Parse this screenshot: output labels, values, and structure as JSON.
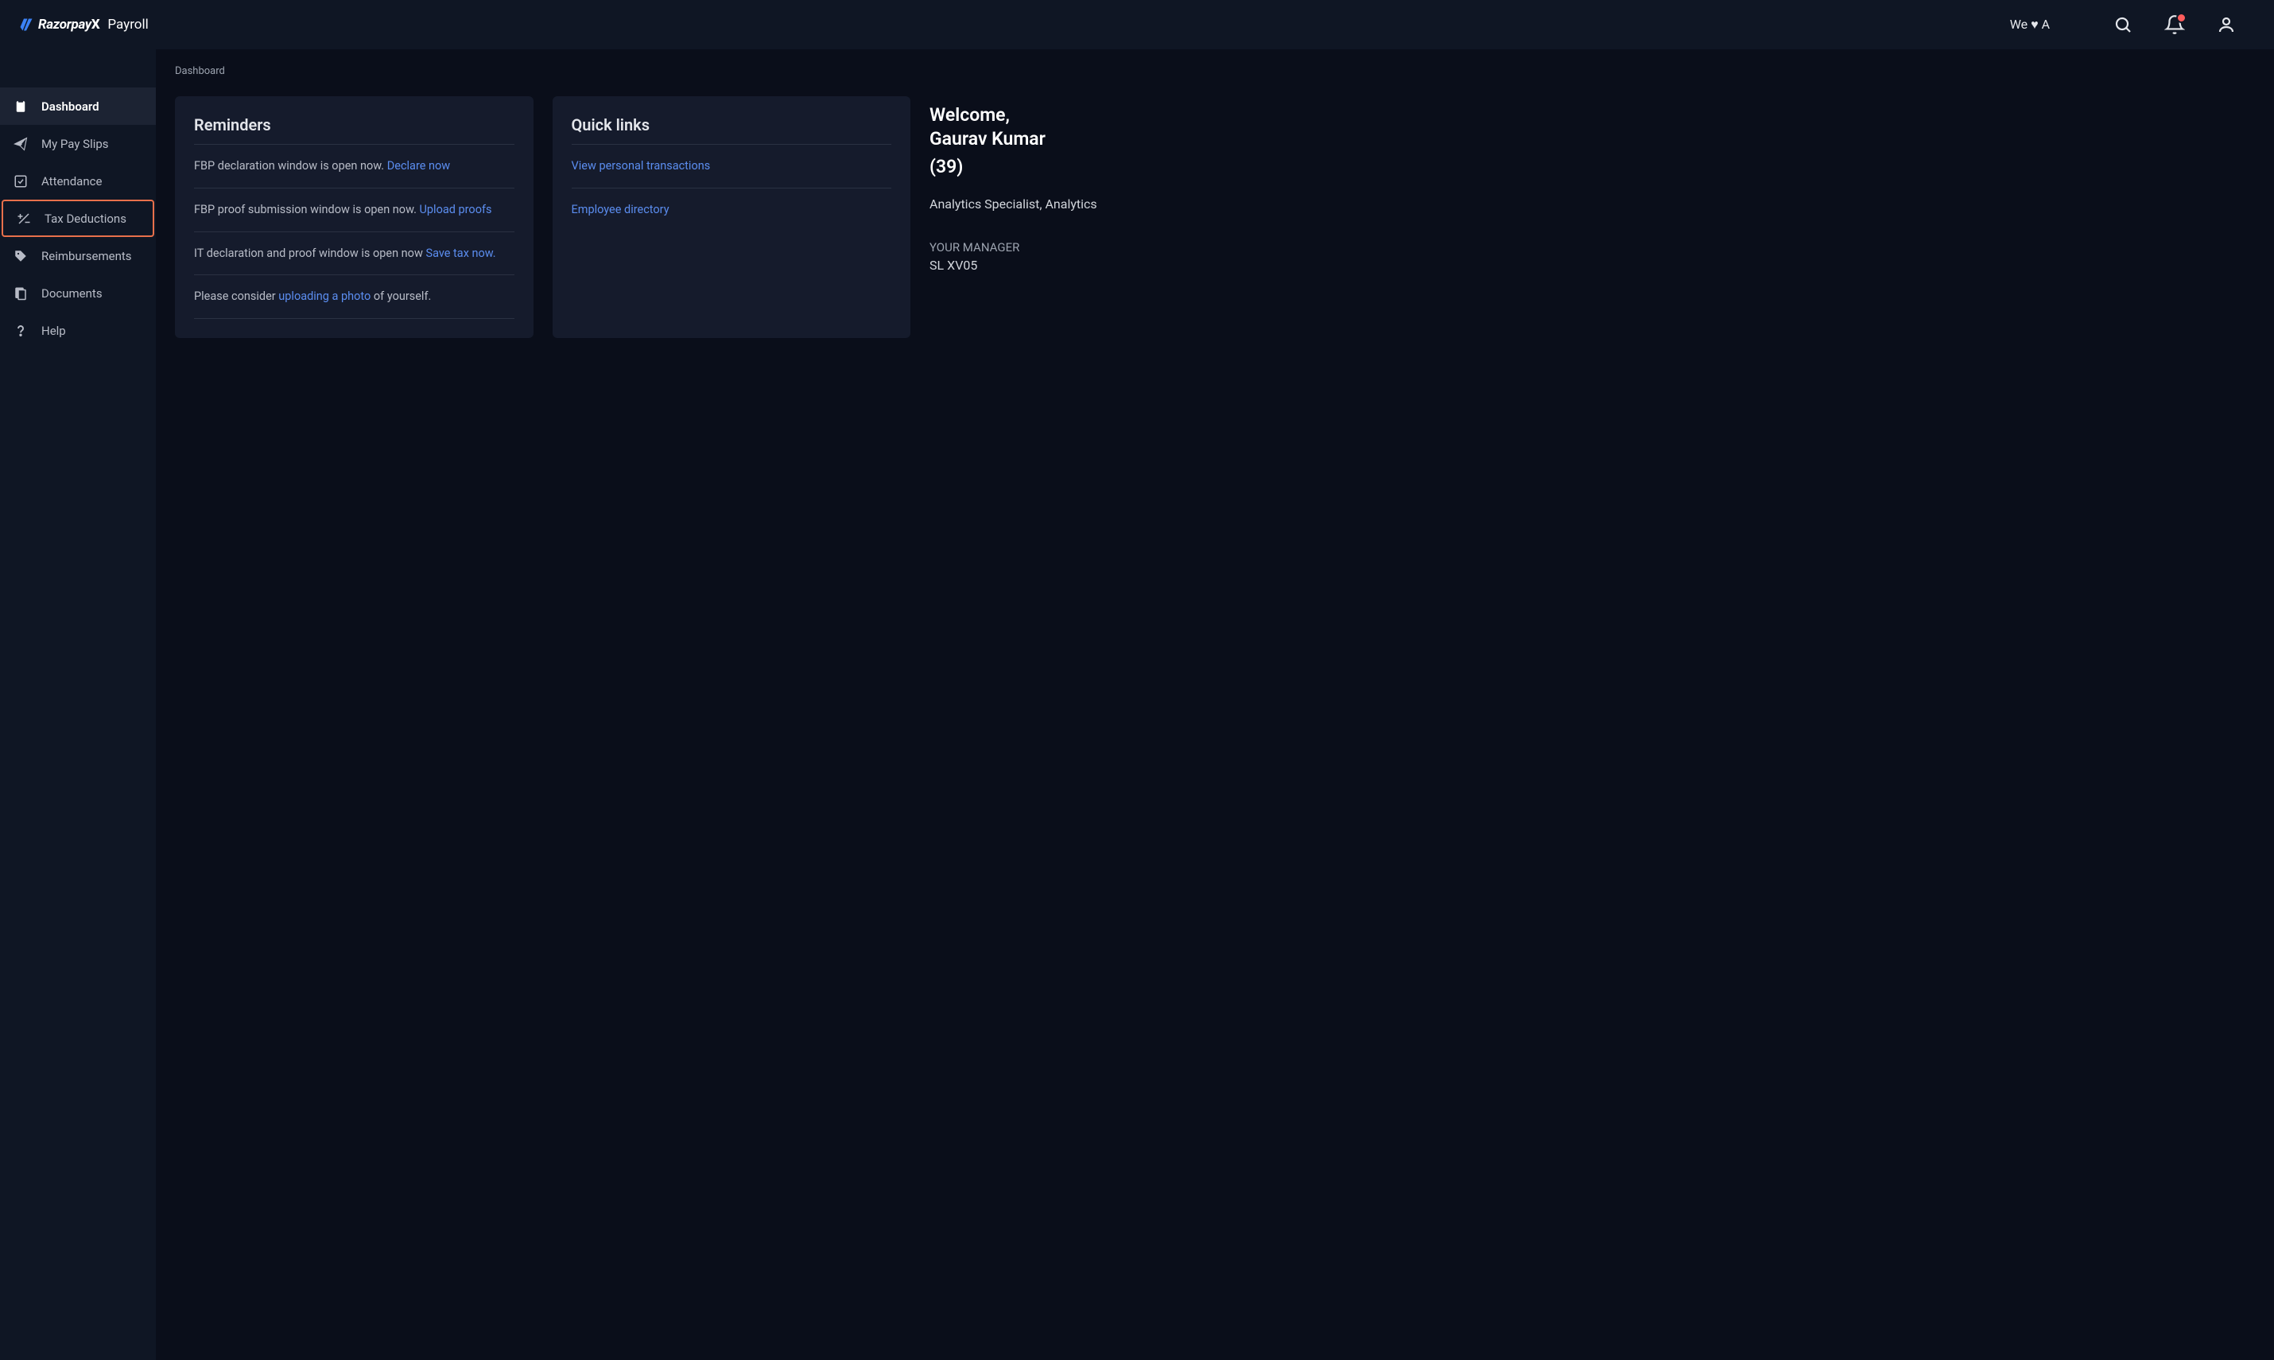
{
  "topbar": {
    "logo_brand": "Razorpay",
    "logo_x": "X",
    "logo_product": "Payroll",
    "org_label": "We ♥ A"
  },
  "sidebar": {
    "items": [
      {
        "icon": "clipboard",
        "label": "Dashboard"
      },
      {
        "icon": "paper-plane",
        "label": "My Pay Slips"
      },
      {
        "icon": "checkbox",
        "label": "Attendance"
      },
      {
        "icon": "plus-minus",
        "label": "Tax Deductions"
      },
      {
        "icon": "tag",
        "label": "Reimbursements"
      },
      {
        "icon": "document",
        "label": "Documents"
      },
      {
        "icon": "question",
        "label": "Help"
      }
    ]
  },
  "breadcrumb": "Dashboard",
  "reminders": {
    "title": "Reminders",
    "items": [
      {
        "prefix": "FBP declaration window is open now. ",
        "link": "Declare now",
        "suffix": ""
      },
      {
        "prefix": "FBP proof submission window is open now. ",
        "link": "Upload proofs",
        "suffix": ""
      },
      {
        "prefix": "IT declaration and proof window is open now ",
        "link": "Save tax now.",
        "suffix": ""
      },
      {
        "prefix": "Please consider ",
        "link": "uploading a photo",
        "suffix": " of yourself."
      }
    ]
  },
  "quicklinks": {
    "title": "Quick links",
    "items": [
      {
        "label": "View personal transactions"
      },
      {
        "label": "Employee directory"
      }
    ]
  },
  "user": {
    "welcome": "Welcome,",
    "name": "Gaurav Kumar",
    "id": "(39)",
    "role": "Analytics Specialist, Analytics",
    "manager_label": "YOUR MANAGER",
    "manager_name": "SL XV05"
  }
}
